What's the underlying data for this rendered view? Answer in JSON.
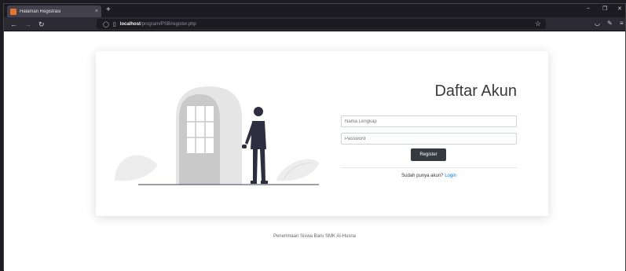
{
  "browser": {
    "tab_title": "Halaman Registrasi",
    "tab_close": "×",
    "new_tab": "+",
    "url_host": "localhost",
    "url_path": "/program/PSB/register.php",
    "window_controls": [
      "–",
      "❐",
      "✕"
    ]
  },
  "form": {
    "title": "Daftar Akun",
    "name_placeholder": "Nama Lengkap",
    "password_placeholder": "Password",
    "register_label": "Register",
    "login_prompt": "Sudah punya akun?",
    "login_link": "Login"
  },
  "footer": {
    "text": "Penerimaan Siswa Baru SMK Al-Husna"
  },
  "colors": {
    "accent_link": "#007bff",
    "button": "#343a40",
    "browser_chrome": "#1c1b22",
    "favicon": "#e8742c"
  },
  "icons": [
    "back-icon",
    "forward-icon",
    "reload-icon",
    "shield-icon",
    "page-icon",
    "bookmark-star-icon",
    "pocket-icon",
    "extension-icon",
    "menu-icon"
  ]
}
